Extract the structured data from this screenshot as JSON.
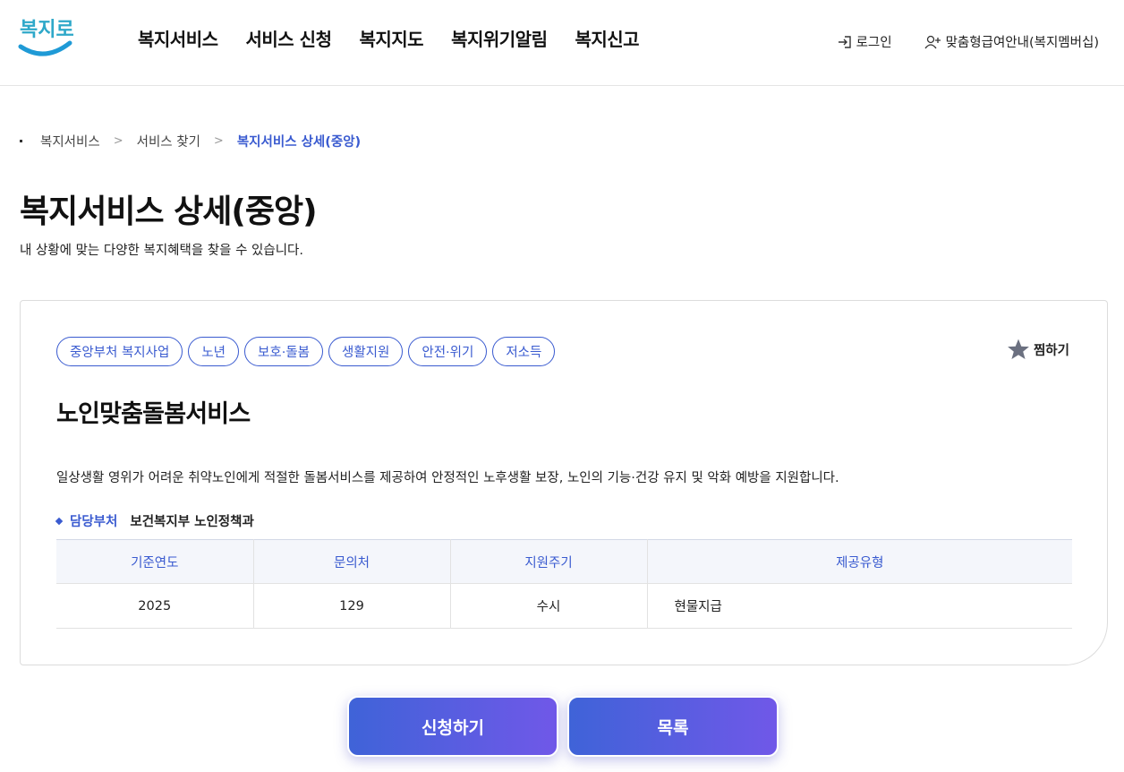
{
  "header": {
    "logo_text": "복지로",
    "nav": [
      "복지서비스",
      "서비스 신청",
      "복지지도",
      "복지위기알림",
      "복지신고"
    ],
    "login_label": "로그인",
    "membership_label": "맞춤형급여안내(복지멤버십)"
  },
  "breadcrumb": [
    "복지서비스",
    "서비스 찾기",
    "복지서비스 상세(중앙)"
  ],
  "page": {
    "title": "복지서비스 상세(중앙)",
    "subtitle": "내 상황에 맞는 다양한 복지혜택을 찾을 수 있습니다."
  },
  "service": {
    "tags": [
      "중앙부처 복지사업",
      "노년",
      "보호·돌봄",
      "생활지원",
      "안전·위기",
      "저소득"
    ],
    "favorite_label": "찜하기",
    "name": "노인맞춤돌봄서비스",
    "description": "일상생활 영위가 어려운 취약노인에게 적절한 돌봄서비스를 제공하여 안정적인 노후생활 보장, 노인의 기능·건강 유지 및 악화 예방을 지원합니다.",
    "dept_label": "담당부처",
    "dept_value": "보건복지부 노인정책과",
    "table": {
      "headers": [
        "기준연도",
        "문의처",
        "지원주기",
        "제공유형"
      ],
      "row": [
        "2025",
        "129",
        "수시",
        "현물지급"
      ]
    }
  },
  "actions": {
    "apply_label": "신청하기",
    "list_label": "목록"
  },
  "colors": {
    "accent": "#3a5bd0",
    "button_gradient_start": "#3f63d8",
    "button_gradient_end": "#7058e8"
  }
}
